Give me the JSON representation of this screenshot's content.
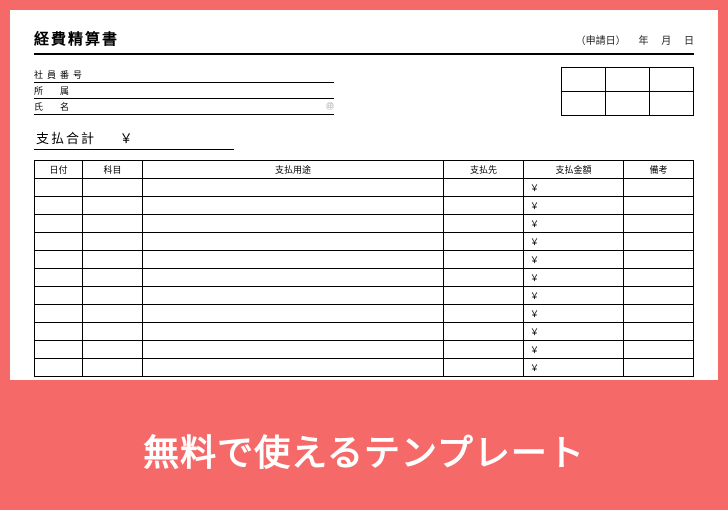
{
  "title": "経費精算書",
  "date_meta": {
    "label": "（申請日）",
    "year": "年",
    "month": "月",
    "day": "日"
  },
  "fields": {
    "employee_id": "社員番号",
    "department": "所　属",
    "name": "氏　名",
    "seal_mark": "㊞"
  },
  "total": {
    "label": "支払合計",
    "symbol": "￥"
  },
  "table": {
    "headers": {
      "date": "日付",
      "subject": "科目",
      "purpose": "支払用途",
      "payee": "支払先",
      "amount": "支払金額",
      "note": "備考"
    },
    "amount_symbol": "￥",
    "row_count": 11
  },
  "banner": "無料で使えるテンプレート"
}
